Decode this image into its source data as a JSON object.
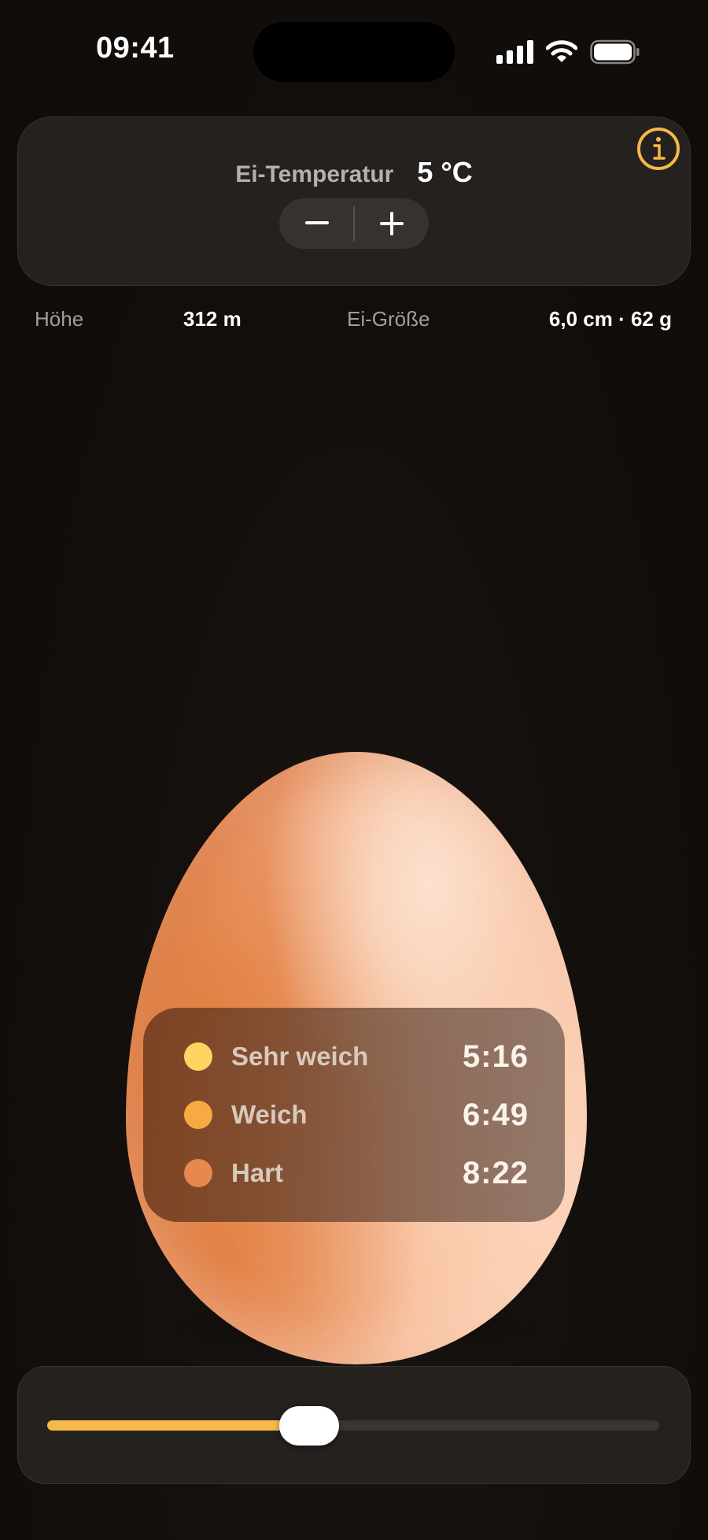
{
  "status_bar": {
    "time": "09:41"
  },
  "temperature": {
    "label": "Ei-Temperatur",
    "value": "5 °C",
    "decrement_symbol": "−",
    "increment_symbol": "+"
  },
  "info_button": {
    "icon": "info-icon",
    "color": "#f5b849"
  },
  "info_row": {
    "altitude_label": "Höhe",
    "altitude_value": "312 m",
    "size_label": "Ei-Größe",
    "size_value": "6,0 cm · 62 g"
  },
  "cook_times": [
    {
      "label": "Sehr weich",
      "time": "5:16",
      "color": "#ffd463"
    },
    {
      "label": "Weich",
      "time": "6:49",
      "color": "#f8aa42"
    },
    {
      "label": "Hart",
      "time": "8:22",
      "color": "#e8884e"
    }
  ],
  "slider": {
    "fraction": 0.5,
    "accent": "#f6b94a"
  }
}
